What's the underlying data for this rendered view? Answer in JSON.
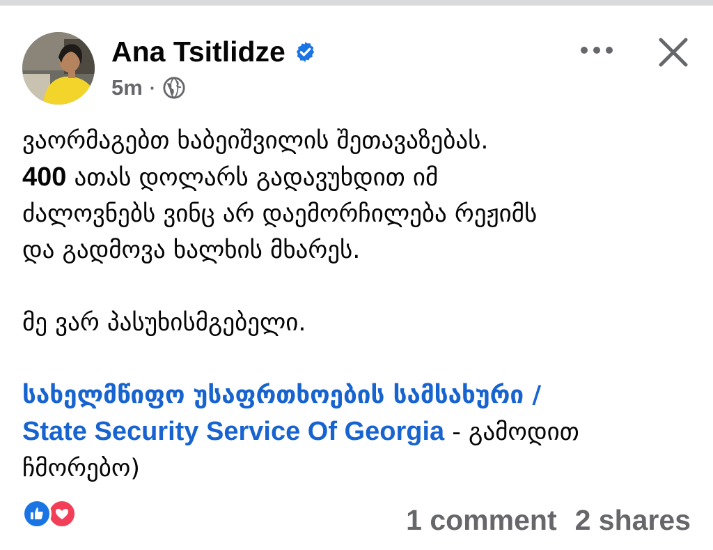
{
  "post": {
    "author": "Ana Tsitlidze",
    "verified_icon": "verified-badge-icon",
    "time": "5m",
    "separator": "·",
    "audience_icon": "globe-icon",
    "more_icon": "more-horizontal-icon",
    "close_icon": "close-icon",
    "line1": "ვაორმაგებთ ხაბეიშვილის შეთავაზებას.",
    "line2_number": "400",
    "line2_rest": " ათას დოლარს გადავუხდით იმ",
    "line3": "ძალოვნებს ვინც არ დაემორჩილება რეჟიმს",
    "line4": "და გადმოვა ხალხის მხარეს.",
    "line5": "მე ვარ პასუხისმგებელი.",
    "mention_ka": "სახელმწიფო უსაფრთხოების სამსახური /",
    "mention_en": "State Security Service Of Georgia",
    "after_mention": " - გამოდით",
    "last_line": "ჩმორებო)",
    "comments": "1 comment",
    "shares": "2 shares",
    "reaction_icons": [
      "like-reaction-icon",
      "love-reaction-icon"
    ],
    "colors": {
      "link": "#1763cf",
      "muted": "#65676b",
      "like": "#1b74e4",
      "love": "#f33e58",
      "verified": "#1b74e4"
    }
  }
}
